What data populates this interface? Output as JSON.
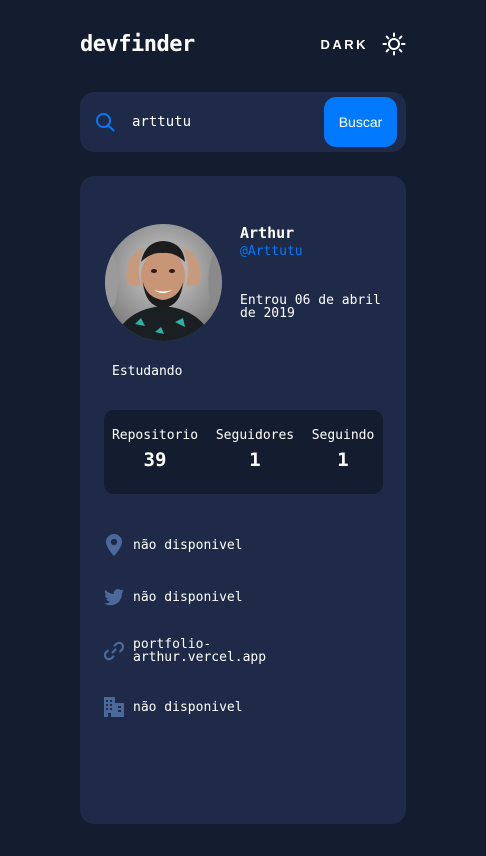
{
  "header": {
    "logo": "devfinder",
    "theme_label": "DARK",
    "theme_icon": "sun-icon"
  },
  "search": {
    "icon": "search-icon",
    "value": "arttutu",
    "button_label": "Buscar"
  },
  "profile": {
    "name": "Arthur",
    "login": "@Arttutu",
    "joined": "Entrou 06 de abril de 2019",
    "bio": "Estudando",
    "stats": [
      {
        "label": "Repositorio",
        "value": "39"
      },
      {
        "label": "Seguidores",
        "value": "1"
      },
      {
        "label": "Seguindo",
        "value": "1"
      }
    ],
    "links": [
      {
        "icon": "location-icon",
        "text": "não disponivel"
      },
      {
        "icon": "twitter-icon",
        "text": "não disponivel"
      },
      {
        "icon": "link-icon",
        "text": "portfolio-arthur.vercel.app"
      },
      {
        "icon": "company-icon",
        "text": "não disponivel"
      }
    ]
  },
  "colors": {
    "background": "#141d2f",
    "card": "#1e2a47",
    "accent": "#0079ff",
    "icon": "#4b6a9b"
  }
}
